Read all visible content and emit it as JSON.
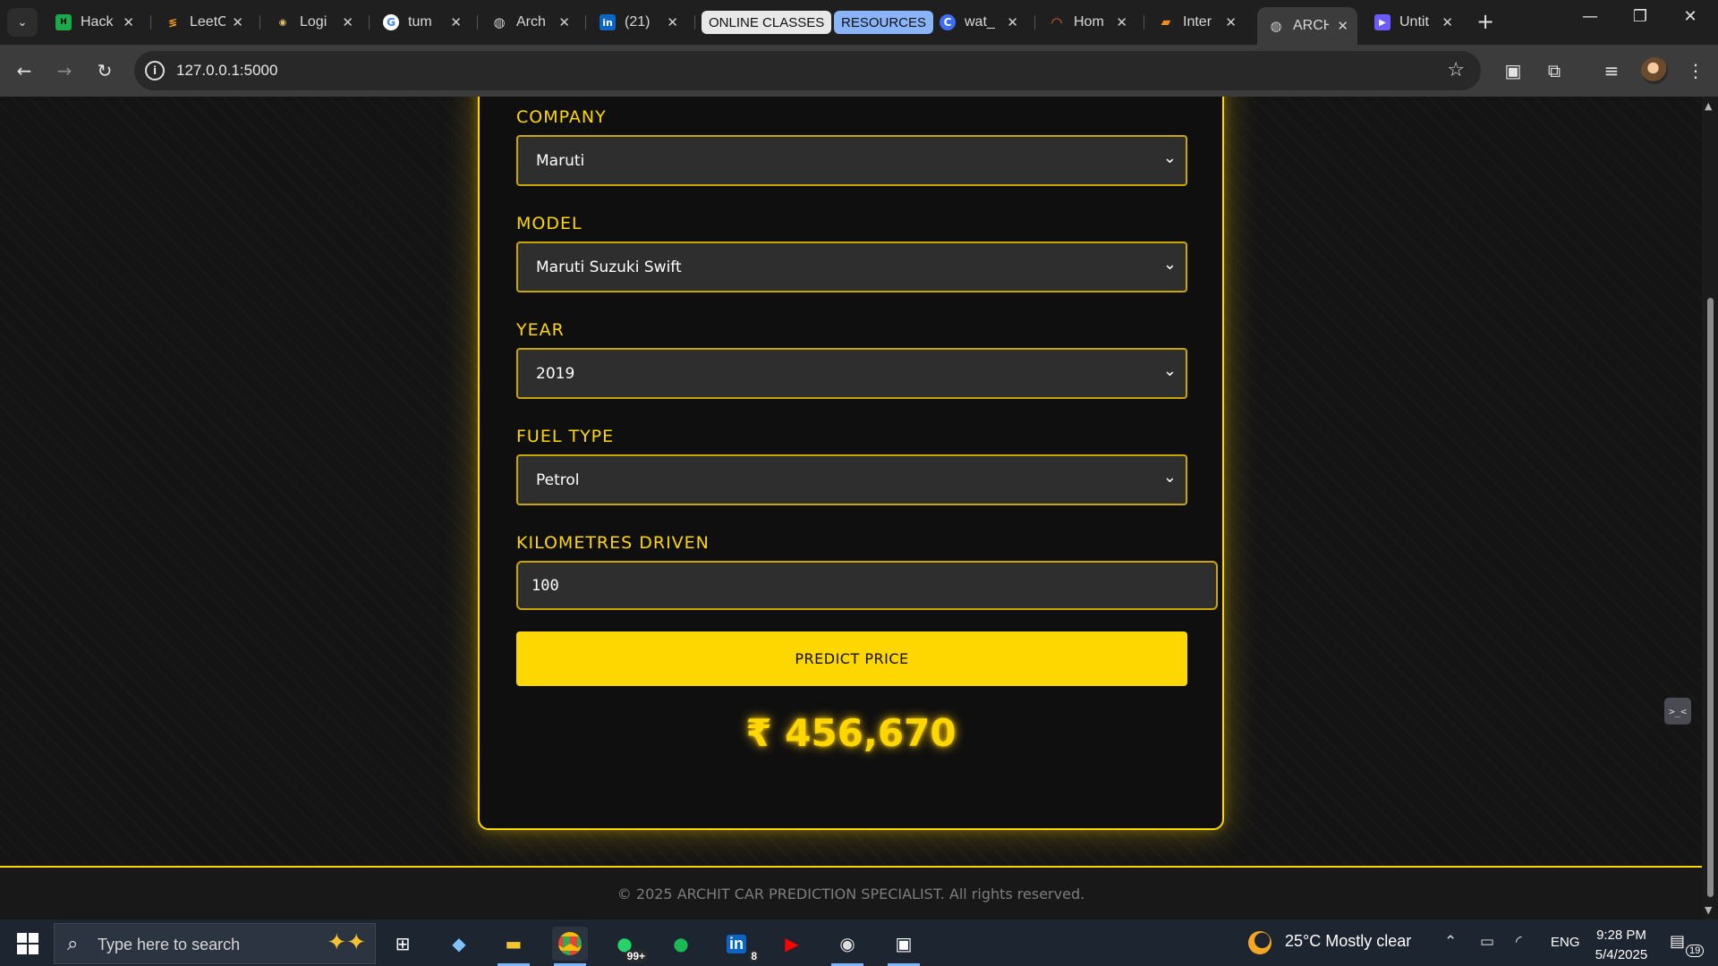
{
  "browser": {
    "tabs": [
      {
        "label": "Hack",
        "icon": "hackerrank-icon"
      },
      {
        "label": "LeetC",
        "icon": "leetcode-icon"
      },
      {
        "label": "Logi",
        "icon": "login-site-icon"
      },
      {
        "label": "tum",
        "icon": "google-icon"
      },
      {
        "label": "Arch",
        "icon": "globe-icon"
      },
      {
        "label": "(21)",
        "icon": "linkedin-icon"
      },
      {
        "label": "wat_",
        "icon": "site-c-icon"
      },
      {
        "label": "Hom",
        "icon": "home-site-icon"
      },
      {
        "label": "Inter",
        "icon": "book-icon"
      },
      {
        "label": "ARCH",
        "icon": "globe-icon"
      },
      {
        "label": "Untit",
        "icon": "video-icon"
      }
    ],
    "bookmark_pills": [
      "ONLINE CLASSES",
      "RESOURCES"
    ],
    "url": "127.0.0.1:5000"
  },
  "form": {
    "company_label": "COMPANY",
    "company_value": "Maruti",
    "model_label": "MODEL",
    "model_value": "Maruti Suzuki Swift",
    "year_label": "YEAR",
    "year_value": "2019",
    "fuel_label": "FUEL TYPE",
    "fuel_value": "Petrol",
    "km_label": "KILOMETRES DRIVEN",
    "km_value": "100",
    "predict_button": "PREDICT PRICE",
    "result": "₹ 456,670"
  },
  "footer": {
    "text": "© 2025 ARCHIT CAR PREDICTION SPECIALIST. All rights reserved."
  },
  "taskbar": {
    "search_placeholder": "Type here to search",
    "whatsapp_badge": "99+",
    "linkedin_badge": "8",
    "weather": "25°C  Mostly clear",
    "language": "ENG",
    "time": "9:28 PM",
    "date": "5/4/2025",
    "notification_count": "19"
  },
  "colors": {
    "accent": "#ffd700",
    "page_bg": "#141414",
    "field_bg": "#2e2e2e"
  }
}
